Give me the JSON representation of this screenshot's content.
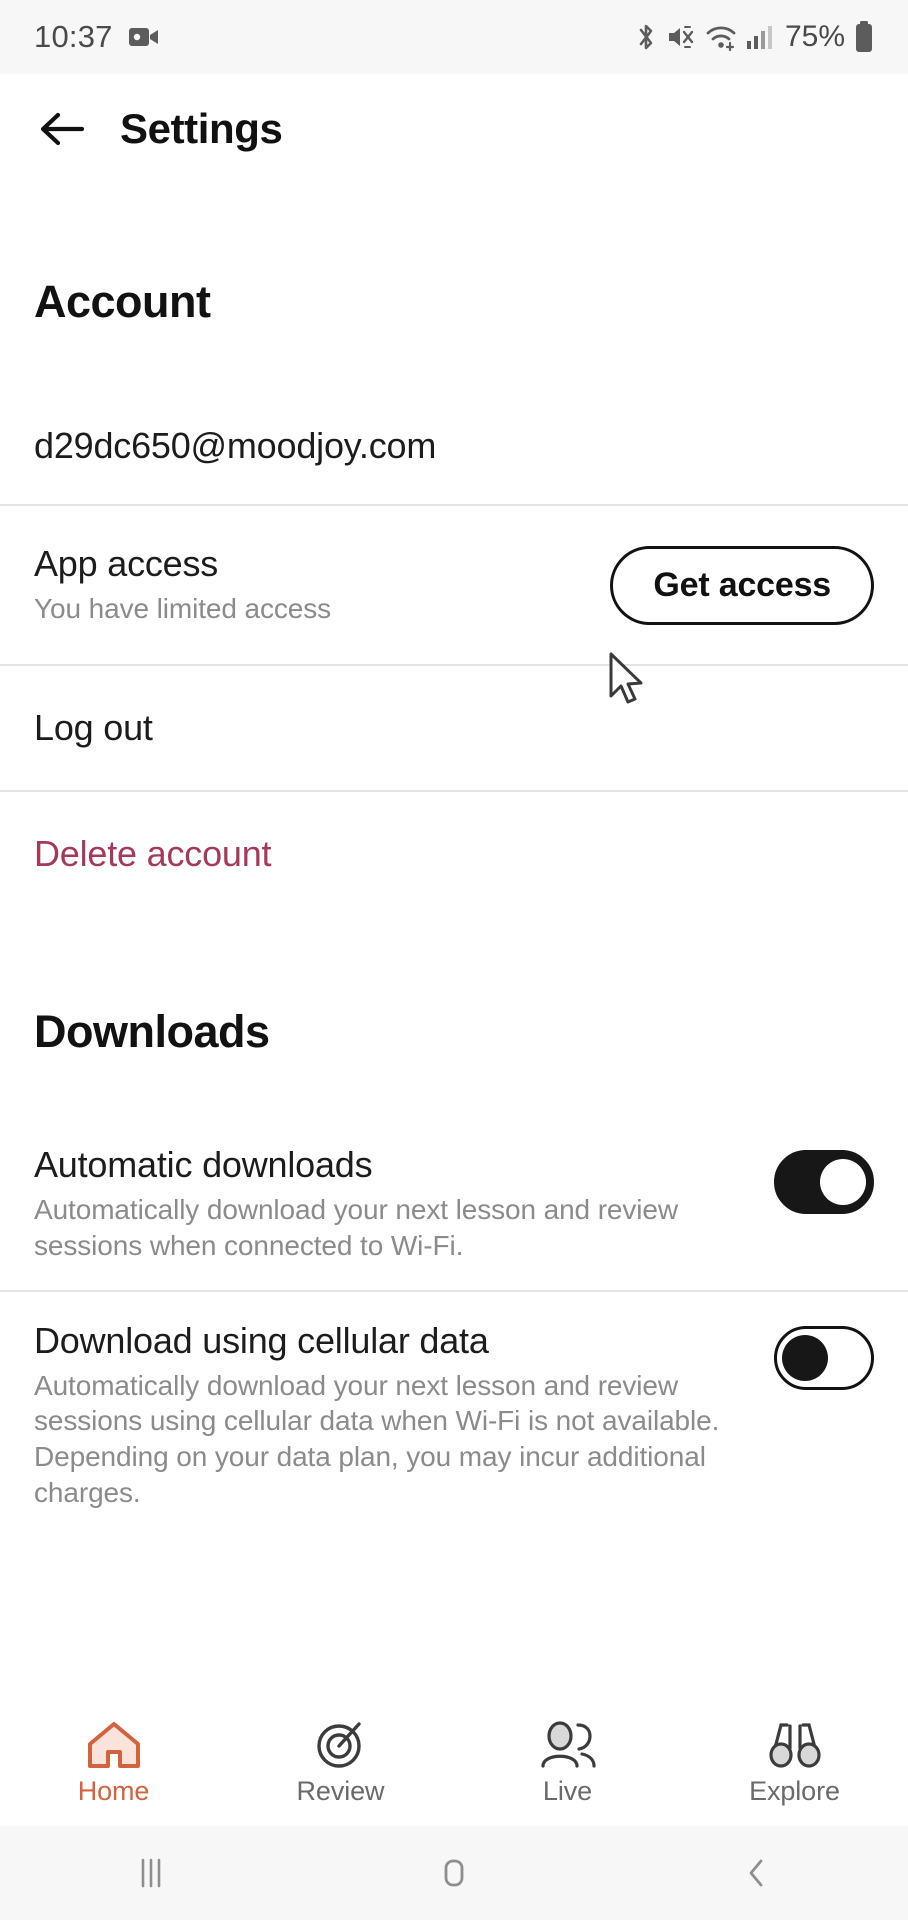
{
  "status_bar": {
    "time": "10:37",
    "battery_percent": "75%",
    "icons": [
      "screen-record-icon",
      "bluetooth-icon",
      "mute-icon",
      "wifi-icon",
      "cellular-signal-icon",
      "battery-icon"
    ]
  },
  "header": {
    "back_icon": "back-arrow-icon",
    "title": "Settings"
  },
  "account": {
    "section_title": "Account",
    "email": "d29dc650@moodjoy.com",
    "app_access": {
      "title": "App access",
      "subtitle": "You have limited access",
      "button_label": "Get access"
    },
    "log_out_label": "Log out",
    "delete_account_label": "Delete account",
    "delete_color": "#a43a58"
  },
  "downloads": {
    "section_title": "Downloads",
    "items": [
      {
        "title": "Automatic downloads",
        "description": "Automatically download your next lesson and review sessions when connected to Wi-Fi.",
        "toggle_state": "on"
      },
      {
        "title": "Download using cellular data",
        "description": "Automatically download your next lesson and review sessions using cellular data when Wi-Fi is not available. Depending on your data plan, you may incur additional charges.",
        "toggle_state": "off"
      }
    ]
  },
  "bottom_nav": {
    "active_color": "#d4623c",
    "items": [
      {
        "label": "Home",
        "icon": "home-icon",
        "active": true
      },
      {
        "label": "Review",
        "icon": "target-icon",
        "active": false
      },
      {
        "label": "Live",
        "icon": "people-icon",
        "active": false
      },
      {
        "label": "Explore",
        "icon": "binoculars-icon",
        "active": false
      }
    ]
  },
  "android_nav": {
    "recents_icon": "recents-icon",
    "home_icon": "home-square-icon",
    "back_icon": "back-chevron-icon"
  }
}
